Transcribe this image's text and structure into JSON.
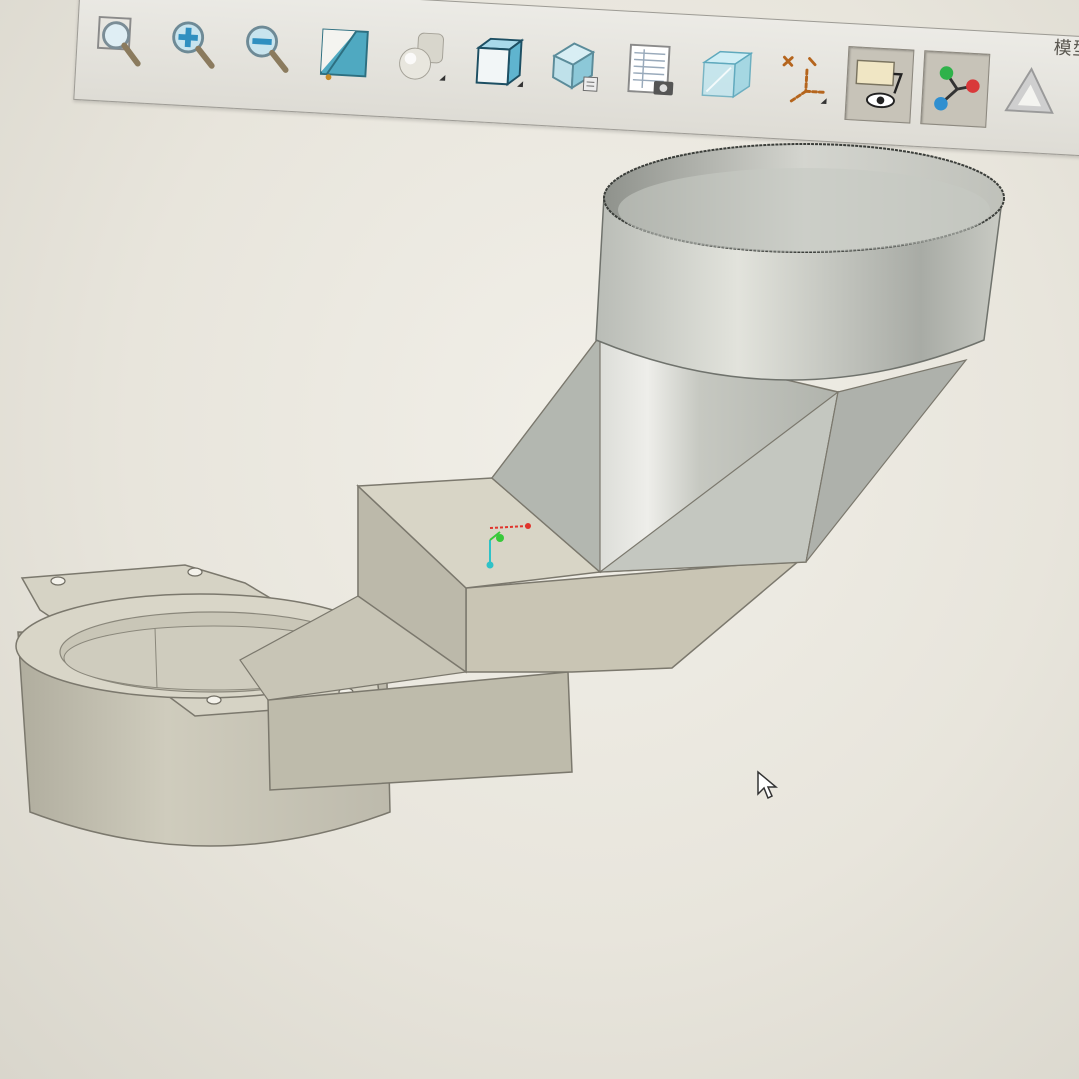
{
  "window": {
    "title_fragment": "模型意"
  },
  "toolbar": {
    "tools": [
      {
        "name": "zoom-fit",
        "icon": "magnifier-icon"
      },
      {
        "name": "zoom-in",
        "icon": "zoom-in-icon"
      },
      {
        "name": "zoom-out",
        "icon": "zoom-out-icon"
      },
      {
        "name": "section-view",
        "icon": "section-plane-icon"
      },
      {
        "name": "shading",
        "icon": "shaded-spheres-icon"
      },
      {
        "name": "standard-views",
        "icon": "cube-view-icon"
      },
      {
        "name": "view-orientation",
        "icon": "cube-orient-icon"
      },
      {
        "name": "snapshot",
        "icon": "sheet-camera-icon"
      },
      {
        "name": "transparency",
        "icon": "transparent-box-icon"
      },
      {
        "name": "coordinate-system",
        "icon": "axes-icon"
      },
      {
        "name": "display-filter",
        "icon": "eye-filter-icon",
        "pressed": true
      },
      {
        "name": "node-graph",
        "icon": "node-graph-icon",
        "pressed": true
      },
      {
        "name": "triangle-mesh",
        "icon": "triangle-icon"
      }
    ]
  },
  "colors": {
    "part_light": "#d9d6c8",
    "part_mid": "#c4c1b1",
    "part_dark": "#a5a294",
    "pipe_light": "#e4e4dc",
    "pipe_dark": "#9da09a",
    "axis_x": "#e0342c",
    "axis_y": "#38c93a",
    "axis_z": "#2fc2c7"
  }
}
